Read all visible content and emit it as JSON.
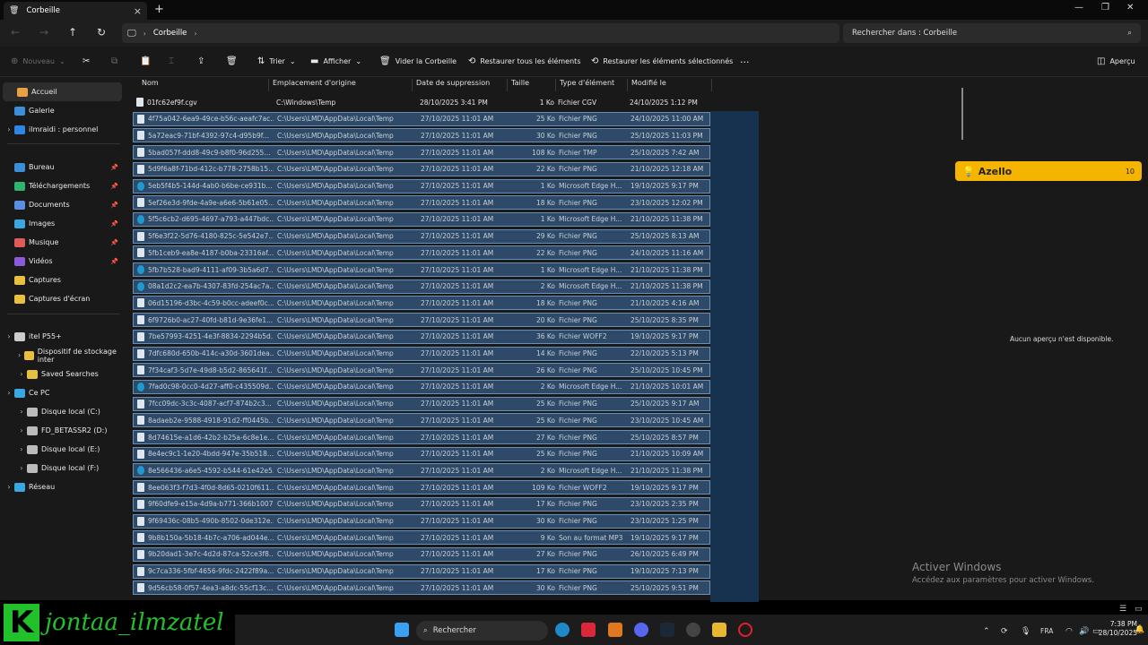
{
  "window": {
    "tab_title": "Corbeille",
    "new_tab": "+"
  },
  "nav": {
    "breadcrumb": "Corbeille",
    "search_placeholder": "Rechercher dans : Corbeille"
  },
  "toolbar": {
    "new": "Nouveau",
    "sort": "Trier",
    "view": "Afficher",
    "empty": "Vider la Corbeille",
    "restore_all": "Restaurer tous les éléments",
    "restore_sel": "Restaurer les éléments sélectionnés",
    "more": "···",
    "preview": "Aperçu"
  },
  "sidebar": [
    {
      "label": "Accueil",
      "icon": "home-icon",
      "color": "#e8a040"
    },
    {
      "label": "Galerie",
      "icon": "gallery-icon",
      "color": "#3a8fd8"
    },
    {
      "label": "ilmraidi : personnel",
      "icon": "cloud-icon",
      "color": "#2f86e0"
    },
    {
      "label": "Bureau",
      "icon": "desktop-icon",
      "color": "#3a8fd8",
      "pin": true
    },
    {
      "label": "Téléchargements",
      "icon": "download-icon",
      "color": "#2fb36f",
      "pin": true
    },
    {
      "label": "Documents",
      "icon": "documents-icon",
      "color": "#5a8ee0",
      "pin": true
    },
    {
      "label": "Images",
      "icon": "pictures-icon",
      "color": "#3aa7e0",
      "pin": true
    },
    {
      "label": "Musique",
      "icon": "music-icon",
      "color": "#e05a5a",
      "pin": true
    },
    {
      "label": "Vidéos",
      "icon": "videos-icon",
      "color": "#8a5ad8",
      "pin": true
    },
    {
      "label": "Captures",
      "icon": "folder-icon",
      "color": "#e8c040"
    },
    {
      "label": "Captures d'écran",
      "icon": "folder-icon",
      "color": "#e8c040"
    },
    {
      "label": "itel P55+",
      "icon": "phone-icon",
      "color": "#cccccc"
    },
    {
      "label": "Dispositif de stockage inter",
      "icon": "folder-icon",
      "color": "#e8c040"
    },
    {
      "label": "Saved Searches",
      "icon": "folder-icon",
      "color": "#e8c040"
    },
    {
      "label": "Ce PC",
      "icon": "pc-icon",
      "color": "#3aa7e0"
    },
    {
      "label": "Disque local (C:)",
      "icon": "drive-icon",
      "color": "#bbbbbb"
    },
    {
      "label": "FD_BETASSR2 (D:)",
      "icon": "drive-icon",
      "color": "#bbbbbb"
    },
    {
      "label": "Disque local (E:)",
      "icon": "drive-icon",
      "color": "#bbbbbb"
    },
    {
      "label": "Disque local (F:)",
      "icon": "drive-icon",
      "color": "#bbbbbb"
    },
    {
      "label": "Réseau",
      "icon": "network-icon",
      "color": "#3aa7e0"
    }
  ],
  "columns": {
    "name": "Nom",
    "origin": "Emplacement d'origine",
    "deleted": "Date de suppression",
    "size": "Taille",
    "type": "Type d'élément",
    "modified": "Modifié le"
  },
  "rows": [
    {
      "name": "01fc62ef9f.cgv",
      "origin": "C:\\Windows\\Temp",
      "deleted": "28/10/2025 3:41 PM",
      "size": "1 Ko",
      "type": "Fichier CGV",
      "modified": "24/10/2025 1:12 PM",
      "sel": false,
      "edge": false
    },
    {
      "name": "4f75a042-6ea9-49ce-b56c-aeafc7ac...",
      "origin": "C:\\Users\\LMD\\AppData\\Local\\Temp",
      "deleted": "27/10/2025 11:01 AM",
      "size": "25 Ko",
      "type": "Fichier PNG",
      "modified": "24/10/2025 11:00 AM",
      "sel": true,
      "edge": false
    },
    {
      "name": "5a72eac9-71bf-4392-97c4-d95b9f...",
      "origin": "C:\\Users\\LMD\\AppData\\Local\\Temp",
      "deleted": "27/10/2025 11:01 AM",
      "size": "30 Ko",
      "type": "Fichier PNG",
      "modified": "25/10/2025 11:03 PM",
      "sel": true,
      "edge": false
    },
    {
      "name": "5bad057f-ddd8-49c9-b8f0-96d255...",
      "origin": "C:\\Users\\LMD\\AppData\\Local\\Temp",
      "deleted": "27/10/2025 11:01 AM",
      "size": "108 Ko",
      "type": "Fichier TMP",
      "modified": "25/10/2025 7:42 AM",
      "sel": true,
      "edge": false
    },
    {
      "name": "5d9f6a8f-71bd-412c-b778-2758b15...",
      "origin": "C:\\Users\\LMD\\AppData\\Local\\Temp",
      "deleted": "27/10/2025 11:01 AM",
      "size": "22 Ko",
      "type": "Fichier PNG",
      "modified": "21/10/2025 12:18 AM",
      "sel": true,
      "edge": false
    },
    {
      "name": "5eb5f4b5-144d-4ab0-b6be-ce931b...",
      "origin": "C:\\Users\\LMD\\AppData\\Local\\Temp",
      "deleted": "27/10/2025 11:01 AM",
      "size": "1 Ko",
      "type": "Microsoft Edge H...",
      "modified": "19/10/2025 9:17 PM",
      "sel": true,
      "edge": true
    },
    {
      "name": "5ef26e3d-9fde-4a9e-a6e6-5b61e05...",
      "origin": "C:\\Users\\LMD\\AppData\\Local\\Temp",
      "deleted": "27/10/2025 11:01 AM",
      "size": "18 Ko",
      "type": "Fichier PNG",
      "modified": "23/10/2025 12:02 PM",
      "sel": true,
      "edge": false
    },
    {
      "name": "5f5c6cb2-d695-4697-a793-a447bdc...",
      "origin": "C:\\Users\\LMD\\AppData\\Local\\Temp",
      "deleted": "27/10/2025 11:01 AM",
      "size": "1 Ko",
      "type": "Microsoft Edge H...",
      "modified": "21/10/2025 11:38 PM",
      "sel": true,
      "edge": true
    },
    {
      "name": "5f6e3f22-5d76-4180-825c-5e542e7...",
      "origin": "C:\\Users\\LMD\\AppData\\Local\\Temp",
      "deleted": "27/10/2025 11:01 AM",
      "size": "29 Ko",
      "type": "Fichier PNG",
      "modified": "25/10/2025 8:13 AM",
      "sel": true,
      "edge": false
    },
    {
      "name": "5fb1ceb9-ea8e-4187-b0ba-23316af...",
      "origin": "C:\\Users\\LMD\\AppData\\Local\\Temp",
      "deleted": "27/10/2025 11:01 AM",
      "size": "22 Ko",
      "type": "Fichier PNG",
      "modified": "24/10/2025 11:16 AM",
      "sel": true,
      "edge": false
    },
    {
      "name": "5fb7b528-bad9-4111-af09-3b5a6d7...",
      "origin": "C:\\Users\\LMD\\AppData\\Local\\Temp",
      "deleted": "27/10/2025 11:01 AM",
      "size": "1 Ko",
      "type": "Microsoft Edge H...",
      "modified": "21/10/2025 11:38 PM",
      "sel": true,
      "edge": true
    },
    {
      "name": "08a1d2c2-ea7b-4307-83fd-254ac7a...",
      "origin": "C:\\Users\\LMD\\AppData\\Local\\Temp",
      "deleted": "27/10/2025 11:01 AM",
      "size": "2 Ko",
      "type": "Microsoft Edge H...",
      "modified": "21/10/2025 11:38 PM",
      "sel": true,
      "edge": true
    },
    {
      "name": "06d15196-d3bc-4c59-b0cc-adeef0c...",
      "origin": "C:\\Users\\LMD\\AppData\\Local\\Temp",
      "deleted": "27/10/2025 11:01 AM",
      "size": "18 Ko",
      "type": "Fichier PNG",
      "modified": "21/10/2025 4:16 AM",
      "sel": true,
      "edge": false
    },
    {
      "name": "6f9726b0-ac27-40fd-b81d-9e36fe1...",
      "origin": "C:\\Users\\LMD\\AppData\\Local\\Temp",
      "deleted": "27/10/2025 11:01 AM",
      "size": "20 Ko",
      "type": "Fichier PNG",
      "modified": "25/10/2025 8:35 PM",
      "sel": true,
      "edge": false
    },
    {
      "name": "7be57993-4251-4e3f-8834-2294b5d...",
      "origin": "C:\\Users\\LMD\\AppData\\Local\\Temp",
      "deleted": "27/10/2025 11:01 AM",
      "size": "36 Ko",
      "type": "Fichier WOFF2",
      "modified": "19/10/2025 9:17 PM",
      "sel": true,
      "edge": false
    },
    {
      "name": "7dfc680d-650b-414c-a30d-3601dea...",
      "origin": "C:\\Users\\LMD\\AppData\\Local\\Temp",
      "deleted": "27/10/2025 11:01 AM",
      "size": "14 Ko",
      "type": "Fichier PNG",
      "modified": "22/10/2025 5:13 PM",
      "sel": true,
      "edge": false
    },
    {
      "name": "7f34caf3-5d7e-49d8-b5d2-865641f...",
      "origin": "C:\\Users\\LMD\\AppData\\Local\\Temp",
      "deleted": "27/10/2025 11:01 AM",
      "size": "26 Ko",
      "type": "Fichier PNG",
      "modified": "25/10/2025 10:45 PM",
      "sel": true,
      "edge": false
    },
    {
      "name": "7fad0c98-0cc0-4d27-aff0-c435509d...",
      "origin": "C:\\Users\\LMD\\AppData\\Local\\Temp",
      "deleted": "27/10/2025 11:01 AM",
      "size": "2 Ko",
      "type": "Microsoft Edge H...",
      "modified": "21/10/2025 10:01 AM",
      "sel": true,
      "edge": true
    },
    {
      "name": "7fcc09dc-3c3c-4087-acf7-874b2c3...",
      "origin": "C:\\Users\\LMD\\AppData\\Local\\Temp",
      "deleted": "27/10/2025 11:01 AM",
      "size": "25 Ko",
      "type": "Fichier PNG",
      "modified": "25/10/2025 9:17 AM",
      "sel": true,
      "edge": false
    },
    {
      "name": "8adaeb2e-9588-4918-91d2-ff0445b...",
      "origin": "C:\\Users\\LMD\\AppData\\Local\\Temp",
      "deleted": "27/10/2025 11:01 AM",
      "size": "25 Ko",
      "type": "Fichier PNG",
      "modified": "23/10/2025 10:45 AM",
      "sel": true,
      "edge": false
    },
    {
      "name": "8d74615e-a1d6-42b2-b25a-6c8e1e...",
      "origin": "C:\\Users\\LMD\\AppData\\Local\\Temp",
      "deleted": "27/10/2025 11:01 AM",
      "size": "27 Ko",
      "type": "Fichier PNG",
      "modified": "25/10/2025 8:57 PM",
      "sel": true,
      "edge": false
    },
    {
      "name": "8e4ec9c1-1e20-4bdd-947e-35b518...",
      "origin": "C:\\Users\\LMD\\AppData\\Local\\Temp",
      "deleted": "27/10/2025 11:01 AM",
      "size": "25 Ko",
      "type": "Fichier PNG",
      "modified": "21/10/2025 10:09 AM",
      "sel": true,
      "edge": false
    },
    {
      "name": "8e566436-a6e5-4592-b544-61e42e5...",
      "origin": "C:\\Users\\LMD\\AppData\\Local\\Temp",
      "deleted": "27/10/2025 11:01 AM",
      "size": "2 Ko",
      "type": "Microsoft Edge H...",
      "modified": "21/10/2025 11:38 PM",
      "sel": true,
      "edge": true
    },
    {
      "name": "8ee063f3-f7d3-4f0d-8d65-0210f611...",
      "origin": "C:\\Users\\LMD\\AppData\\Local\\Temp",
      "deleted": "27/10/2025 11:01 AM",
      "size": "109 Ko",
      "type": "Fichier WOFF2",
      "modified": "19/10/2025 9:17 PM",
      "sel": true,
      "edge": false
    },
    {
      "name": "9f60dfe9-e15a-4d9a-b771-366b1007...",
      "origin": "C:\\Users\\LMD\\AppData\\Local\\Temp",
      "deleted": "27/10/2025 11:01 AM",
      "size": "17 Ko",
      "type": "Fichier PNG",
      "modified": "23/10/2025 2:35 PM",
      "sel": true,
      "edge": false
    },
    {
      "name": "9f69436c-08b5-490b-8502-0de312e...",
      "origin": "C:\\Users\\LMD\\AppData\\Local\\Temp",
      "deleted": "27/10/2025 11:01 AM",
      "size": "30 Ko",
      "type": "Fichier PNG",
      "modified": "23/10/2025 1:25 PM",
      "sel": true,
      "edge": false
    },
    {
      "name": "9b8b150a-5b18-4b7c-a706-ad044e...",
      "origin": "C:\\Users\\LMD\\AppData\\Local\\Temp",
      "deleted": "27/10/2025 11:01 AM",
      "size": "9 Ko",
      "type": "Son au format MP3",
      "modified": "19/10/2025 9:17 PM",
      "sel": true,
      "edge": false
    },
    {
      "name": "9b20dad1-3e7c-4d2d-87ca-52ce3f8...",
      "origin": "C:\\Users\\LMD\\AppData\\Local\\Temp",
      "deleted": "27/10/2025 11:01 AM",
      "size": "27 Ko",
      "type": "Fichier PNG",
      "modified": "26/10/2025 6:49 PM",
      "sel": true,
      "edge": false
    },
    {
      "name": "9c7ca336-5fbf-4656-9fdc-2422f89a...",
      "origin": "C:\\Users\\LMD\\AppData\\Local\\Temp",
      "deleted": "27/10/2025 11:01 AM",
      "size": "17 Ko",
      "type": "Fichier PNG",
      "modified": "19/10/2025 7:13 PM",
      "sel": true,
      "edge": false
    },
    {
      "name": "9d56cb58-0f57-4ea3-a8dc-55cf13c...",
      "origin": "C:\\Users\\LMD\\AppData\\Local\\Temp",
      "deleted": "27/10/2025 11:01 AM",
      "size": "30 Ko",
      "type": "Fichier PNG",
      "modified": "25/10/2025 9:51 PM",
      "sel": true,
      "edge": false
    }
  ],
  "preview": {
    "no_preview": "Aucun aperçu n'est disponible."
  },
  "azello": {
    "label": "Azello",
    "count": "10"
  },
  "watermark": {
    "title": "Activer Windows",
    "subtitle": "Accédez aux paramètres pour activer Windows."
  },
  "streamer": {
    "logo": "K",
    "name": "jontaa_ilmzatel"
  },
  "taskbar": {
    "search": "Rechercher",
    "lang": "FRA",
    "time": "7:38 PM",
    "date": "28/10/2025"
  }
}
